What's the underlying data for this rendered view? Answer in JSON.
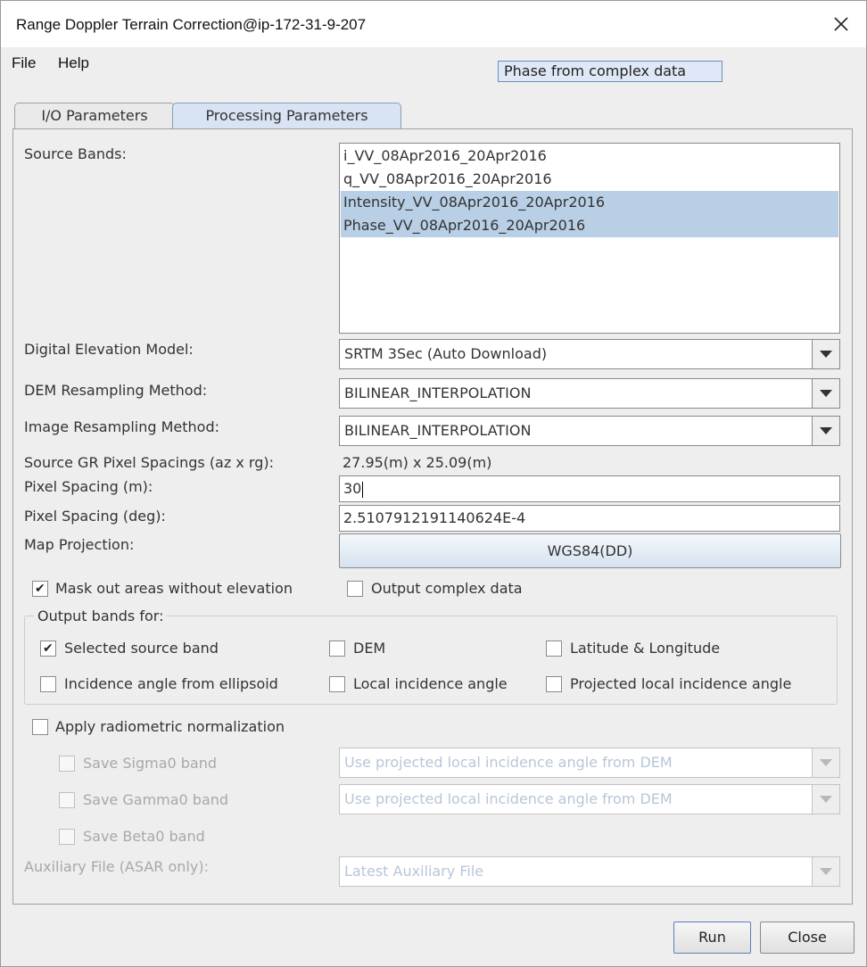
{
  "window": {
    "title": "Range Doppler Terrain Correction@ip-172-31-9-207"
  },
  "menu": {
    "file": "File",
    "help": "Help"
  },
  "tooltip": "Phase from complex data",
  "tabs": {
    "io": "I/O Parameters",
    "processing": "Processing Parameters"
  },
  "form": {
    "source_bands_label": "Source Bands:",
    "source_bands": [
      {
        "name": "i_VV_08Apr2016_20Apr2016",
        "selected": false
      },
      {
        "name": "q_VV_08Apr2016_20Apr2016",
        "selected": false
      },
      {
        "name": "Intensity_VV_08Apr2016_20Apr2016",
        "selected": true
      },
      {
        "name": "Phase_VV_08Apr2016_20Apr2016",
        "selected": true
      }
    ],
    "dem_label": "Digital Elevation Model:",
    "dem_value": "SRTM 3Sec (Auto Download)",
    "dem_resampling_label": "DEM Resampling Method:",
    "dem_resampling_value": "BILINEAR_INTERPOLATION",
    "img_resampling_label": "Image Resampling Method:",
    "img_resampling_value": "BILINEAR_INTERPOLATION",
    "source_gr_label": "Source GR Pixel Spacings (az x rg):",
    "source_gr_value": "27.95(m) x 25.09(m)",
    "pixel_spacing_m_label": "Pixel Spacing (m):",
    "pixel_spacing_m_value": "30",
    "pixel_spacing_deg_label": "Pixel Spacing (deg):",
    "pixel_spacing_deg_value": "2.5107912191140624E-4",
    "map_projection_label": "Map Projection:",
    "map_projection_value": "WGS84(DD)",
    "mask_label": "Mask out areas without elevation",
    "mask_checked": true,
    "output_complex_label": "Output complex data",
    "output_complex_checked": false
  },
  "output_bands": {
    "title": "Output bands for:",
    "selected_source_band": "Selected source band",
    "dem": "DEM",
    "lat_lon": "Latitude & Longitude",
    "incidence_ellipsoid": "Incidence angle from ellipsoid",
    "local_incidence": "Local incidence angle",
    "projected_local_incidence": "Projected local incidence angle"
  },
  "radiometric": {
    "apply_label": "Apply radiometric normalization",
    "sigma0_label": "Save Sigma0 band",
    "sigma0_value": "Use projected local incidence angle from DEM",
    "gamma0_label": "Save Gamma0 band",
    "gamma0_value": "Use projected local incidence angle from DEM",
    "beta0_label": "Save Beta0 band",
    "aux_label": "Auxiliary File (ASAR only):",
    "aux_value": "Latest Auxiliary File"
  },
  "buttons": {
    "run": "Run",
    "close": "Close"
  }
}
